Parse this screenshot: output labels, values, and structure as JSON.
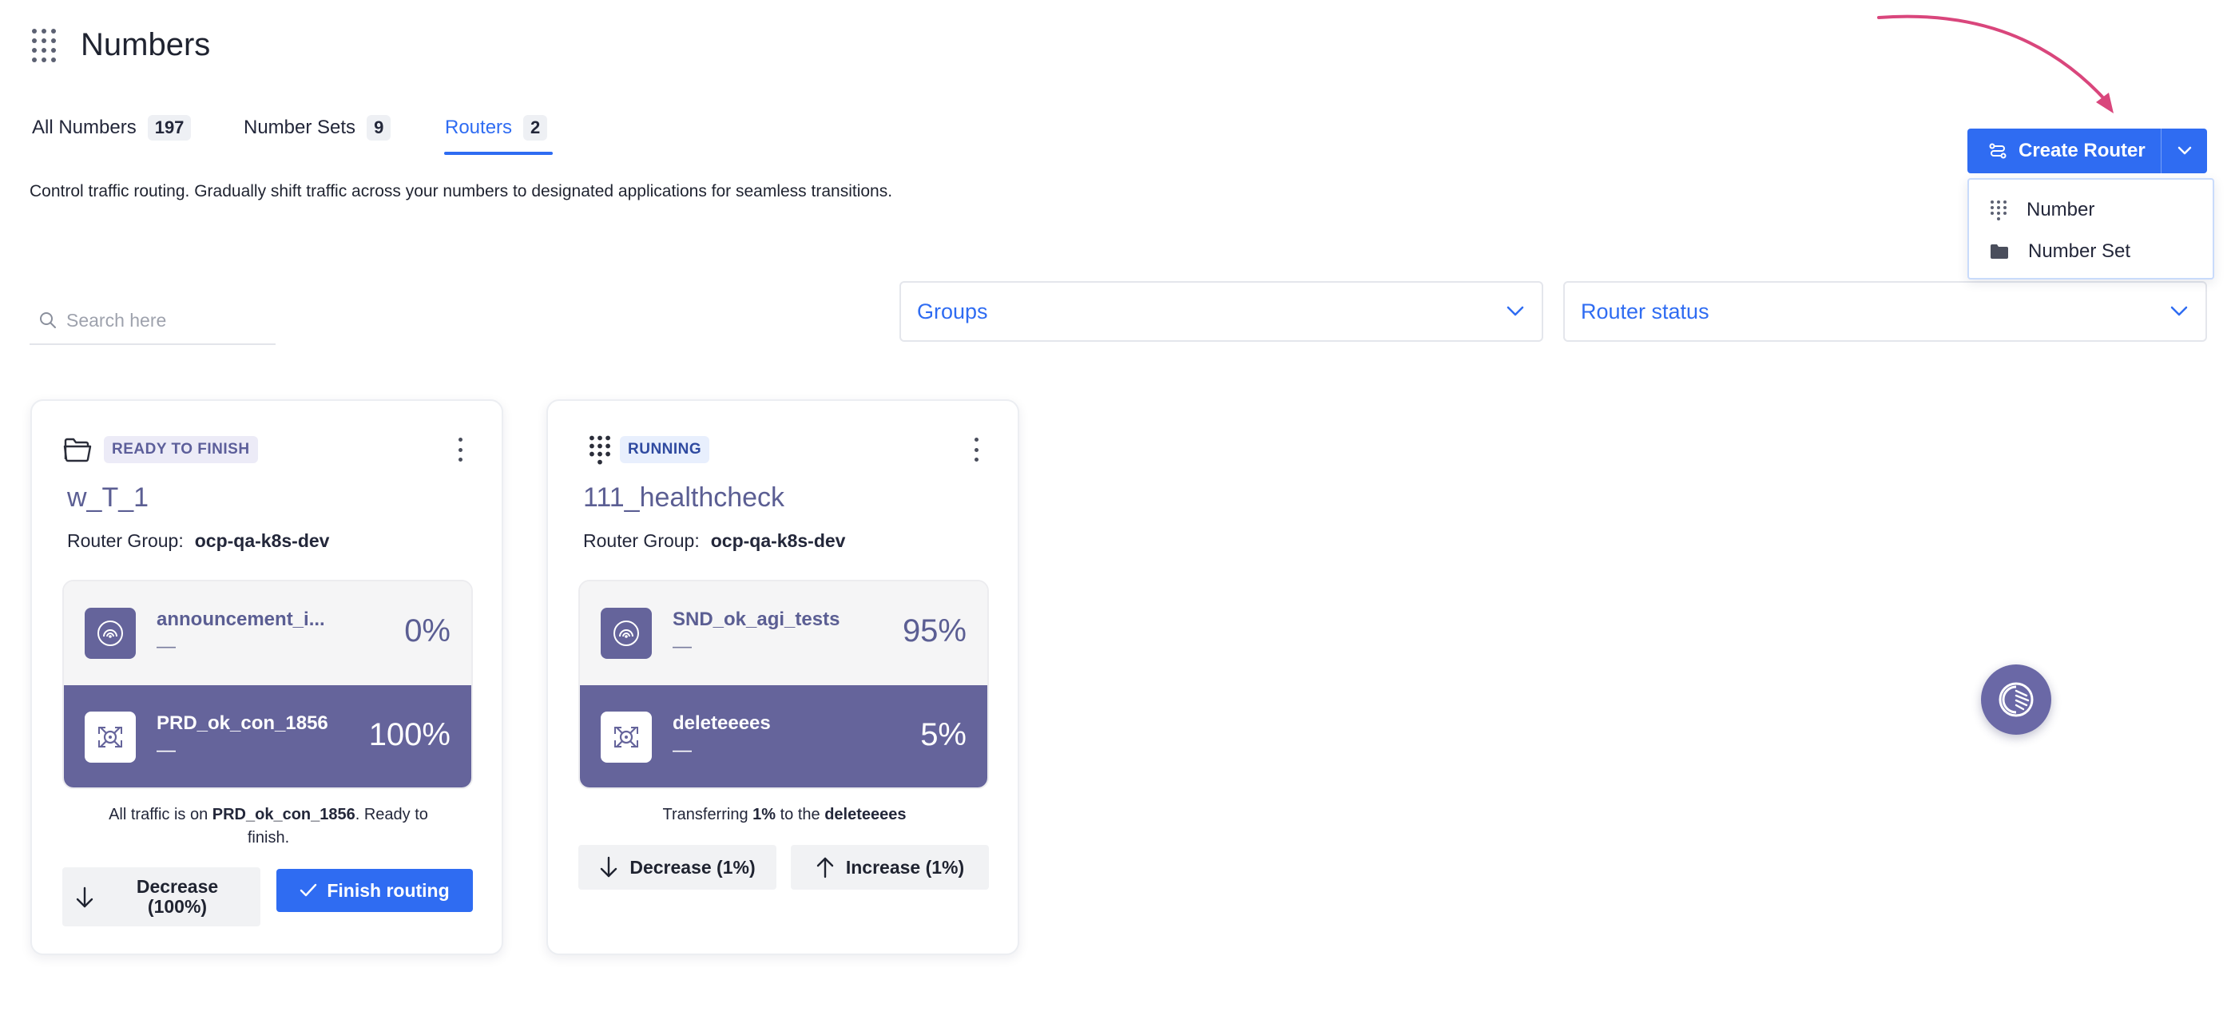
{
  "header": {
    "title": "Numbers",
    "grid_icon": "app-grid-icon"
  },
  "tabs": [
    {
      "label": "All Numbers",
      "count": "197",
      "active": false
    },
    {
      "label": "Number Sets",
      "count": "9",
      "active": false
    },
    {
      "label": "Routers",
      "count": "2",
      "active": true
    }
  ],
  "subtitle": "Control traffic routing. Gradually shift traffic across your numbers to designated applications for seamless transitions.",
  "search": {
    "placeholder": "Search here"
  },
  "filters": {
    "groups_label": "Groups",
    "status_label": "Router status"
  },
  "create_button": {
    "label": "Create Router"
  },
  "create_menu": [
    {
      "label": "Number",
      "icon": "dialpad-icon"
    },
    {
      "label": "Number Set",
      "icon": "folder-icon"
    }
  ],
  "cards": [
    {
      "status": "READY TO FINISH",
      "type_icon": "folder-icon",
      "name": "w_T_1",
      "group_label": "Router Group:",
      "group_value": "ocp-qa-k8s-dev",
      "source": {
        "name": "announcement_i...",
        "sub": "—",
        "percent": "0%"
      },
      "target": {
        "name": "PRD_ok_con_1856",
        "sub": "—",
        "percent": "100%"
      },
      "status_prefix": "All traffic is on ",
      "status_bold": "PRD_ok_con_1856",
      "status_suffix": ". Ready to finish.",
      "btn_decrease": "Decrease (100%)",
      "btn_finish": "Finish routing"
    },
    {
      "status": "RUNNING",
      "type_icon": "dialpad-icon",
      "name": "111_healthcheck",
      "group_label": "Router Group:",
      "group_value": "ocp-qa-k8s-dev",
      "source": {
        "name": "SND_ok_agi_tests",
        "sub": "—",
        "percent": "95%"
      },
      "target": {
        "name": "deleteeees",
        "sub": "—",
        "percent": "5%"
      },
      "status_prefix": "Transferring ",
      "status_bold": "1%",
      "status_middle": " to the ",
      "status_bold2": "deleteeees",
      "btn_decrease": "Decrease (1%)",
      "btn_increase": "Increase (1%)"
    }
  ],
  "colors": {
    "accent": "#2f6cf2",
    "card_purple": "#65649b",
    "annotation_arrow": "#d9467c"
  }
}
